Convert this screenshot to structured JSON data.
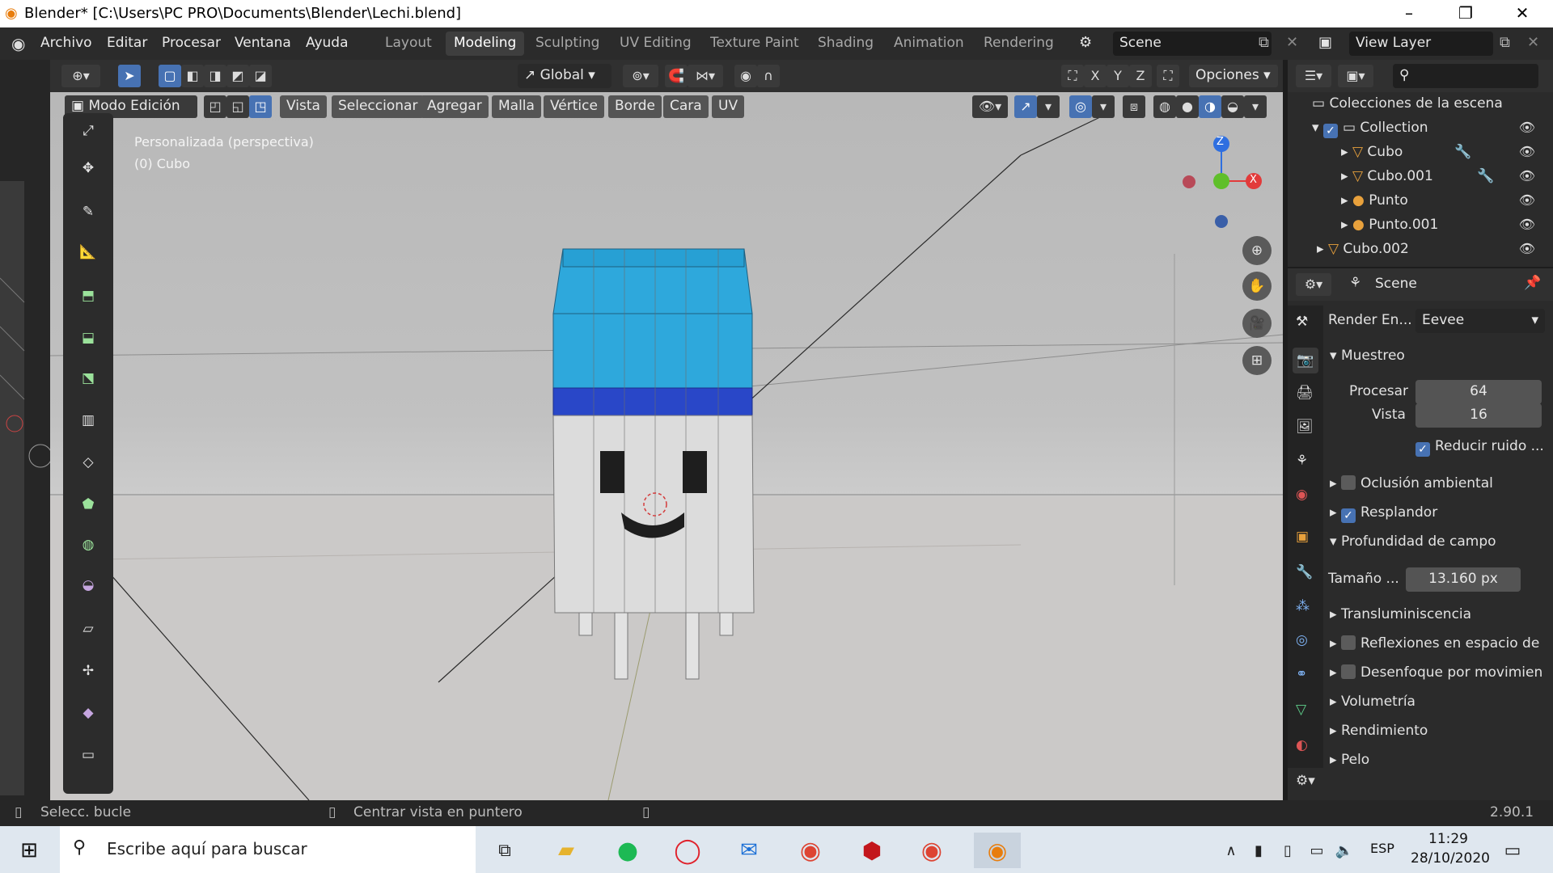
{
  "window": {
    "title": "Blender* [C:\\Users\\PC PRO\\Documents\\Blender\\Lechi.blend]"
  },
  "menu": {
    "items": [
      "Archivo",
      "Editar",
      "Procesar",
      "Ventana",
      "Ayuda"
    ]
  },
  "workspaces": {
    "tabs": [
      "Layout",
      "Modeling",
      "Sculpting",
      "UV Editing",
      "Texture Paint",
      "Shading",
      "Animation",
      "Rendering"
    ],
    "active": "Modeling"
  },
  "scene": {
    "name": "Scene"
  },
  "view_layer": {
    "name": "View Layer"
  },
  "tool_header": {
    "orientation": "Global",
    "options": "Opciones",
    "axes": [
      "X",
      "Y",
      "Z"
    ]
  },
  "viewport_header": {
    "mode": "Modo Edición",
    "menus": [
      "Vista",
      "Seleccionar",
      "Agregar",
      "Malla",
      "Vértice",
      "Borde",
      "Cara",
      "UV"
    ]
  },
  "viewport": {
    "view_name": "Personalizada (perspectiva)",
    "object_info": "(0) Cubo"
  },
  "gizmo": {
    "z": "Z",
    "x": "X"
  },
  "outliner": {
    "root": "Colecciones de la escena",
    "collection": "Collection",
    "items": [
      "Cubo",
      "Cubo.001",
      "Punto",
      "Punto.001",
      "Cubo.002"
    ]
  },
  "properties": {
    "context": "Scene",
    "render_engine_label": "Render En...",
    "render_engine": "Eevee",
    "sampling": "Muestreo",
    "render_label": "Procesar",
    "render_value": "64",
    "viewport_label": "Vista",
    "viewport_value": "16",
    "denoise": "Reducir ruido ...",
    "panels": {
      "ao": "Oclusión ambiental",
      "bloom": "Resplandor",
      "dof": "Profundidad de campo",
      "dof_size_label": "Tamaño ...",
      "dof_size_value": "13.160 px",
      "sss": "Transluminiscencia",
      "ssr": "Reflexiones en espacio de",
      "motion_blur": "Desenfoque por movimien",
      "volumetrics": "Volumetría",
      "performance": "Rendimiento",
      "hair": "Pelo"
    }
  },
  "statusbar": {
    "left": "Selecc. bucle",
    "middle": "Centrar vista en puntero",
    "version": "2.90.1"
  },
  "taskbar": {
    "search_placeholder": "Escribe aquí para buscar",
    "lang": "ESP",
    "time": "11:29",
    "date": "28/10/2020"
  },
  "colors": {
    "accent": "#4772b3",
    "carton_top": "#2ea8dc",
    "carton_band": "#2947c8",
    "carton_body": "#dcdcdc"
  }
}
